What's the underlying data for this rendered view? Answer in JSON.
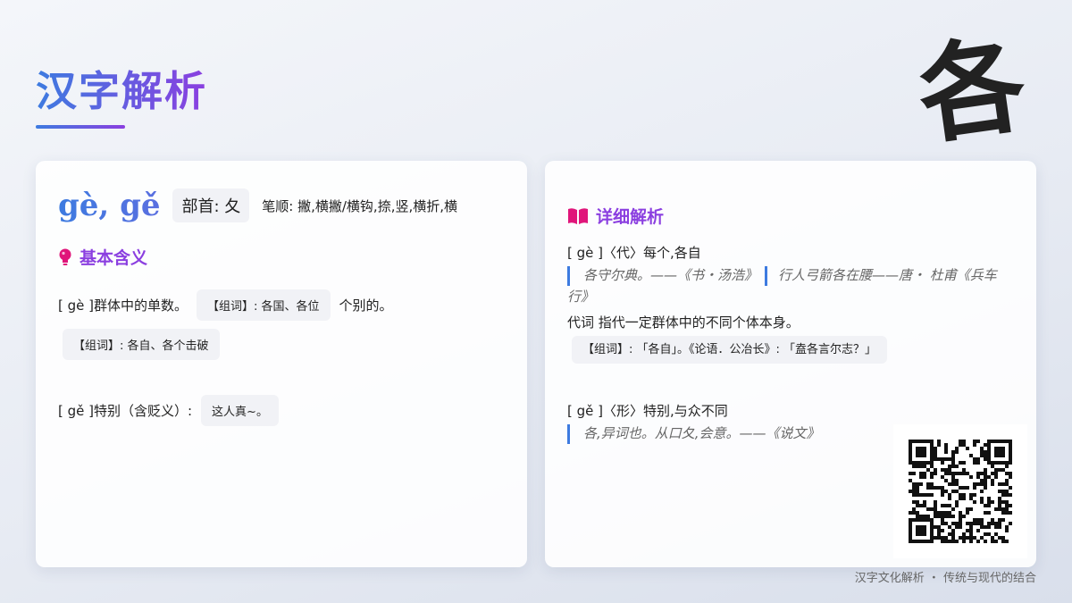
{
  "header": {
    "title": "汉字解析",
    "character": "各"
  },
  "left_card": {
    "pinyin": "gè, gě",
    "radical": "部首: 夂",
    "strokes": "笔顺: 撇,横撇/横钩,捺,竖,横折,横",
    "section_title": "基本含义",
    "def1_label": "[ gè ]群体中的单数。",
    "def1_chip": "【组词】: 各国、各位",
    "def1_tail": "个别的。",
    "def1_chip2": "【组词】: 各自、各个击破",
    "def2_label": "[ gě ]特别（含贬义）:",
    "def2_chip": "这人真~。"
  },
  "right_card": {
    "section_title": "详细解析",
    "ge4_head": "[ gè ]〈代〉每个,各自",
    "ge4_quote1": "各守尔典。——《书・汤浩》",
    "ge4_quote2": "行人弓箭各在腰——唐・ 杜甫《兵车行》",
    "ge4_desc": "代词 指代一定群体中的不同个体本身。",
    "ge4_chip": "【组词】: 「各自」。《论语．公冶长》: 「盍各言尔志？」",
    "ge3_head": "[ gě ]〈形〉特别,与众不同",
    "ge3_quote": "各,异词也。从口夂,会意。——《说文》"
  },
  "footer": "汉字文化解析 ・ 传统与现代的结合",
  "colors": {
    "accent_blue": "#3d7be0",
    "accent_purple": "#8b3fe0",
    "icon_pink": "#e0157a"
  },
  "icons": {
    "basic_meaning": "lightbulb-icon",
    "detail": "book-icon"
  }
}
